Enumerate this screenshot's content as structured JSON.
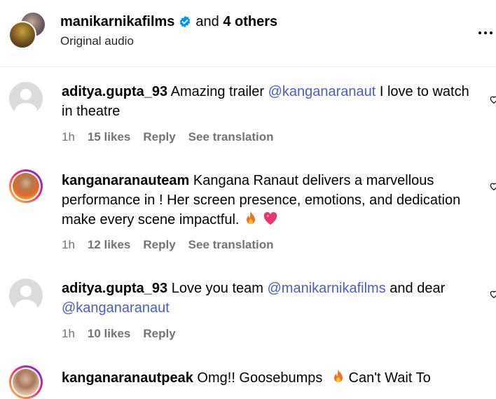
{
  "header": {
    "username": "manikarnikafilms",
    "and_text": "and",
    "others": "4 others",
    "subtitle": "Original audio",
    "verified_icon": "verified-badge-icon",
    "more_icon": "more-options-icon"
  },
  "colors": {
    "mention": "#4a5cc7",
    "meta": "#737373",
    "verified": "#0095f6"
  },
  "comments": [
    {
      "username": "aditya.gupta_93",
      "text_before": "Amazing trailer ",
      "mention": "@kanganaranaut",
      "text_after": " I love to watch in theatre",
      "time": "1h",
      "likes": "15 likes",
      "reply": "Reply",
      "translation": "See translation"
    },
    {
      "username": "kanganaranauteam",
      "text": "Kangana Ranaut delivers a marvellous performance in ! Her screen presence, emotions, and dedication make every scene impactful.",
      "emojis": [
        "fire-emoji",
        "heart-emoji"
      ],
      "time": "1h",
      "likes": "12 likes",
      "reply": "Reply",
      "translation": "See translation"
    },
    {
      "username": "aditya.gupta_93",
      "text_before": "Love you team ",
      "mention": "@manikarnikafilms",
      "text_middle": " and dear ",
      "mention2": "@kanganaranaut",
      "time": "1h",
      "likes": "10 likes",
      "reply": "Reply"
    },
    {
      "username": "kanganaranautpeak",
      "text_before": "Omg!! Goosebumps ",
      "emoji": "fire-emoji",
      "text_after": " Can't Wait To"
    }
  ]
}
